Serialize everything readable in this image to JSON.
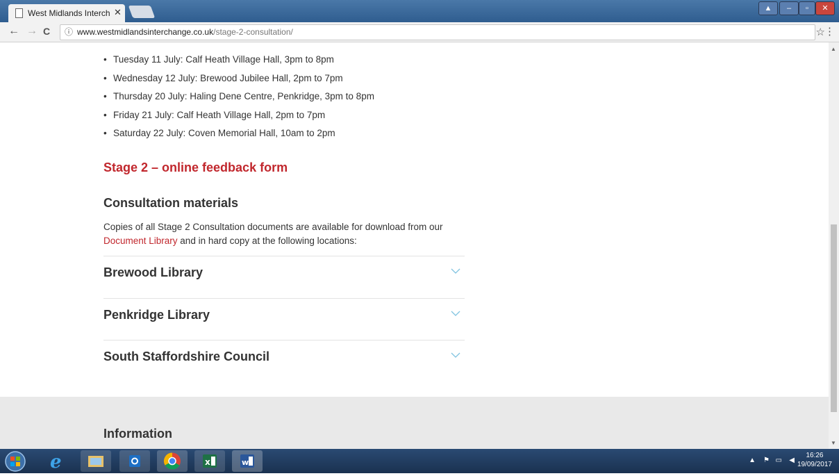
{
  "browser": {
    "tab_title": "West Midlands Interchan",
    "tab_close": "✕",
    "url_host": "www.westmidlandsinterchange.co.uk",
    "url_path": "/stage-2-consultation/",
    "back": "←",
    "forward": "→",
    "reload": "C",
    "info_icon": "ⓘ",
    "star": "☆",
    "menu": "⋮"
  },
  "events": [
    "Tuesday 11 July: Calf Heath Village Hall, 3pm to 8pm",
    "Wednesday 12 July: Brewood Jubilee Hall, 2pm to 7pm",
    "Thursday 20 July: Haling Dene Centre, Penkridge, 3pm to 8pm",
    "Friday 21 July: Calf Heath Village Hall, 2pm to 7pm",
    "Saturday 22 July: Coven Memorial Hall, 10am to 2pm"
  ],
  "stage2_heading": "Stage 2 – online feedback form",
  "materials": {
    "heading": "Consultation materials",
    "text_before": "Copies of all Stage 2 Consultation documents are available for download from our ",
    "link": "Document Library",
    "text_after": " and in hard copy at the following locations:"
  },
  "locations": [
    "Brewood Library",
    "Penkridge Library",
    "South Staffordshire Council"
  ],
  "info_heading": "Information",
  "colors": {
    "accent": "#c1272d",
    "chevron": "#7fc3e0"
  },
  "taskbar": {
    "time": "16:26",
    "date": "19/09/2017"
  }
}
